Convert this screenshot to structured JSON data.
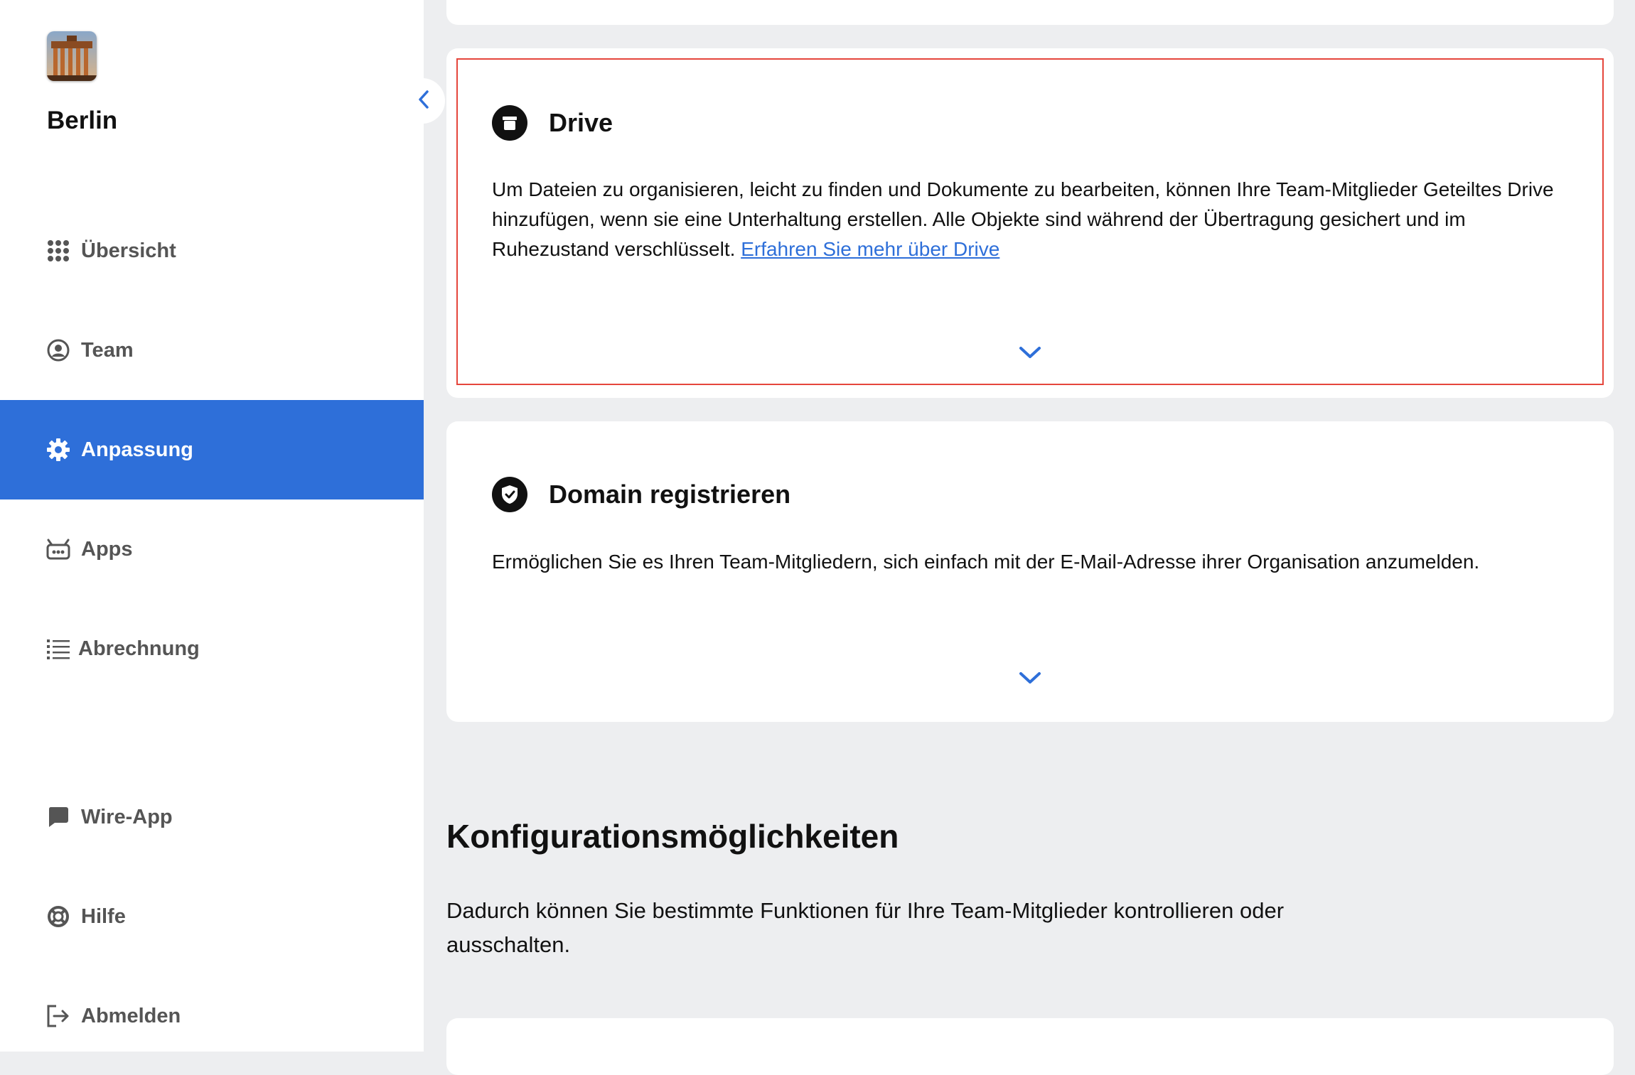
{
  "sidebar": {
    "team_name": "Berlin",
    "team_logo": "brandenburg-gate-photo",
    "collapse_icon": "chevron-left-icon",
    "nav_items": [
      {
        "label": "Übersicht",
        "icon": "grid-icon"
      },
      {
        "label": "Team",
        "icon": "user-circle-icon"
      },
      {
        "label": "Anpassung",
        "icon": "gear-icon",
        "active": true
      },
      {
        "label": "Apps",
        "icon": "robot-icon"
      },
      {
        "label": "Abrechnung",
        "icon": "list-icon"
      },
      {
        "label": "Wire-App",
        "icon": "chat-bubble-icon"
      },
      {
        "label": "Hilfe",
        "icon": "lifebuoy-icon"
      },
      {
        "label": "Abmelden",
        "icon": "logout-icon"
      }
    ]
  },
  "cards": {
    "drive": {
      "title": "Drive",
      "icon": "archive-box-icon",
      "text": "Um Dateien zu organisieren, leicht zu finden und Dokumente zu bearbeiten, können Ihre Team-Mitglieder Geteiltes Drive hinzufügen, wenn sie eine Unterhaltung erstellen. Alle Objekte sind während der Übertragung gesichert und im Ruhezustand verschlüsselt.",
      "link_label": "Erfahren Sie mehr über Drive",
      "expand_icon": "chevron-down-icon",
      "highlighted": true
    },
    "domain": {
      "title": "Domain registrieren",
      "icon": "shield-check-icon",
      "text": "Ermöglichen Sie es Ihren Team-Mitgliedern, sich einfach mit der E-Mail-Adresse ihrer Organisation anzumelden.",
      "expand_icon": "chevron-down-icon"
    }
  },
  "config_section": {
    "title": "Konfigurationsmöglichkeiten",
    "description": "Dadurch können Sie bestimmte Funktionen für Ihre Team-Mitglieder kontrollieren oder ausschalten."
  },
  "colors": {
    "accent": "#2e6fd9",
    "highlight_border": "#e5463c",
    "background": "#edeef0"
  }
}
